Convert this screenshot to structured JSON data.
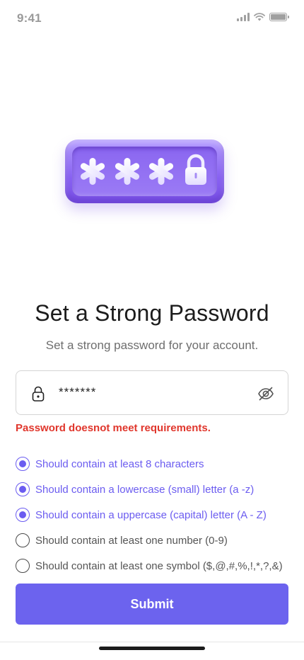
{
  "status_bar": {
    "time": "9:41"
  },
  "hero": {
    "icon": "password-lock-illustration"
  },
  "header": {
    "title": "Set a Strong Password",
    "subtitle": "Set a strong password for your account."
  },
  "password_field": {
    "value": "*******",
    "lock_icon": "lock-icon",
    "toggle_icon": "eye-off-icon"
  },
  "error": {
    "text": "Password doesnot meet requirements."
  },
  "requirements": [
    {
      "label": "Should contain at least 8 characters",
      "met": true
    },
    {
      "label": "Should contain a lowercase (small) letter (a -z)",
      "met": true
    },
    {
      "label": "Should contain a uppercase (capital) letter (A - Z)",
      "met": true
    },
    {
      "label": "Should contain at least one number (0-9)",
      "met": false
    },
    {
      "label": "Should contain at least one symbol ($,@,#,%,!,*,?,&)",
      "met": false
    }
  ],
  "submit": {
    "label": "Submit"
  },
  "colors": {
    "accent": "#6c63ee",
    "error": "#e0362c",
    "met_text": "#6b5cf0"
  }
}
